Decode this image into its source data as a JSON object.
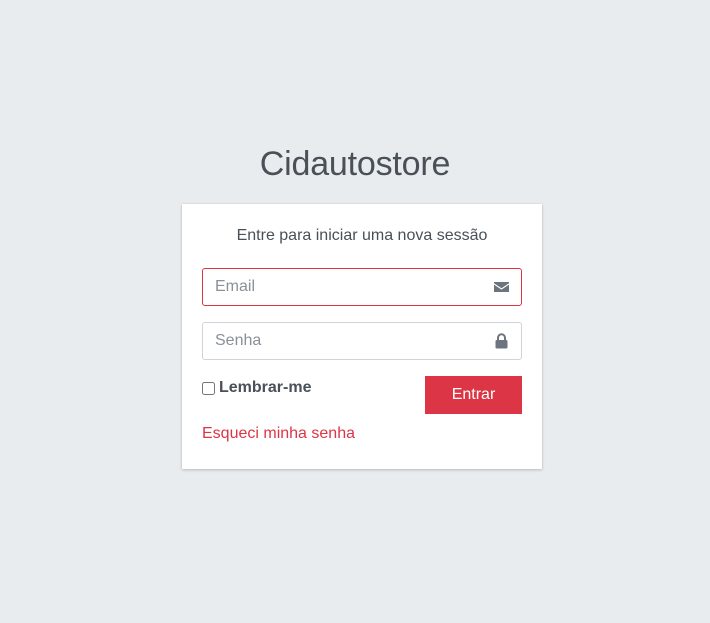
{
  "logo": {
    "bold_part": "Cidauto",
    "light_part": "store"
  },
  "card": {
    "message": "Entre para iniciar uma nova sessão",
    "email": {
      "placeholder": "Email",
      "value": "",
      "icon": "envelope-icon",
      "state": "invalid",
      "border_color": "#dc3545"
    },
    "password": {
      "placeholder": "Senha",
      "value": "",
      "icon": "lock-icon"
    },
    "remember": {
      "label": "Lembrar-me",
      "checked": false
    },
    "submit_label": "Entrar",
    "forgot_label": "Esqueci minha senha"
  },
  "colors": {
    "background": "#e9ecef",
    "accent": "#dc3545",
    "text": "#495057"
  }
}
